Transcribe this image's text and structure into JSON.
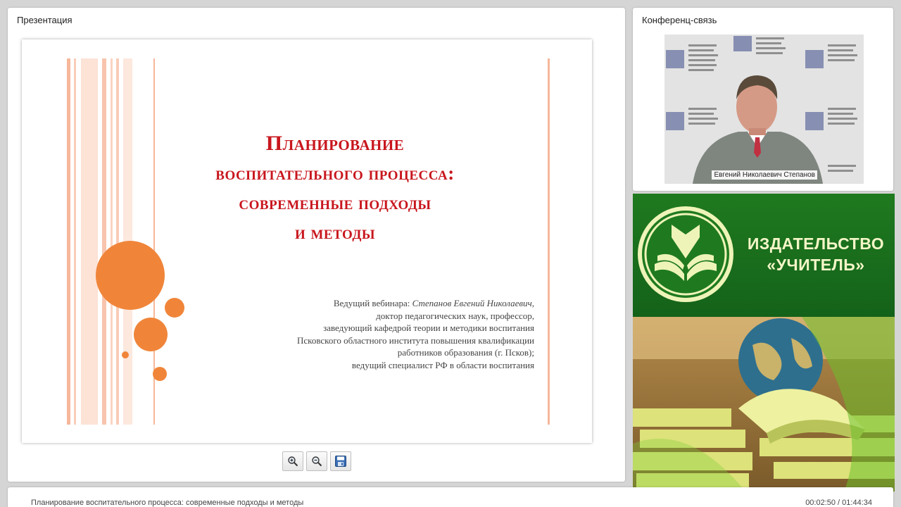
{
  "presentation": {
    "panel_title": "Презентация",
    "slide": {
      "title_first": "Планирование",
      "title_lines": [
        "воспитательного процесса:",
        "современные подходы",
        "и методы"
      ],
      "credits_prefix": "Ведущий вебинара: ",
      "credits_name": "Степанов Евгений Николаевич,",
      "credits_lines": [
        "доктор педагогических наук, профессор,",
        "заведующий кафедрой теории и методики воспитания",
        "Псковского областного института повышения квалификации",
        "работников образования (г. Псков);",
        "ведущий специалист РФ в области воспитания"
      ]
    },
    "tools": [
      {
        "name": "zoom-in-button",
        "icon": "zoom-in-icon"
      },
      {
        "name": "zoom-out-button",
        "icon": "zoom-out-icon"
      },
      {
        "name": "save-button",
        "icon": "save-icon"
      }
    ]
  },
  "conference": {
    "panel_title": "Конференц-связь",
    "speaker_name": "Евгений Николаевич Степанов"
  },
  "publisher": {
    "name_line1": "ИЗДАТЕЛЬСТВО",
    "name_line2": "«УЧИТЕЛЬ»"
  },
  "status": {
    "title": "Планирование воспитательного процесса: современные подходы и методы",
    "time": "00:02:50 / 01:44:34"
  },
  "colors": {
    "slide_title": "#c8161d",
    "circles": "#f0853a",
    "banner_green": "#1f7a1f",
    "banner_text": "#f4f6c8"
  }
}
